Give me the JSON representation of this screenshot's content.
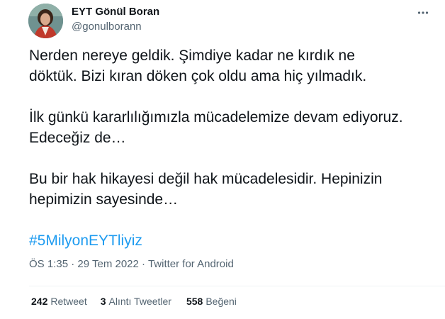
{
  "author": {
    "name": "EYT Gönül Boran",
    "handle": "@gonulborann"
  },
  "tweet": {
    "paragraphs": [
      [
        "Nerden nereye geldik. Şimdiye kadar ne kırdık ne",
        "döktük. Bizi kıran döken çok oldu ama hiç yılmadık."
      ],
      [
        "İlk günkü kararlılığımızla mücadelemize devam ediyoruz.",
        "Edeceğiz de…"
      ],
      [
        "Bu bir hak hikayesi değil hak mücadelesidir. Hepinizin",
        "hepimizin sayesinde…"
      ]
    ],
    "hashtag": "#5MilyonEYTliyiz"
  },
  "meta": {
    "time": "ÖS 1:35",
    "separator": "·",
    "date": "29 Tem 2022",
    "source": "Twitter for Android"
  },
  "stats": {
    "retweets_count": "242",
    "retweets_label": "Retweet",
    "quotes_count": "3",
    "quotes_label": "Alıntı Tweetler",
    "likes_count": "558",
    "likes_label": "Beğeni"
  },
  "icons": {
    "more": "more-horizontal-icon",
    "avatar": "profile-photo"
  },
  "colors": {
    "link": "#1d9bf0",
    "text": "#0f1419",
    "secondary": "#536471",
    "divider": "#eff3f4"
  }
}
